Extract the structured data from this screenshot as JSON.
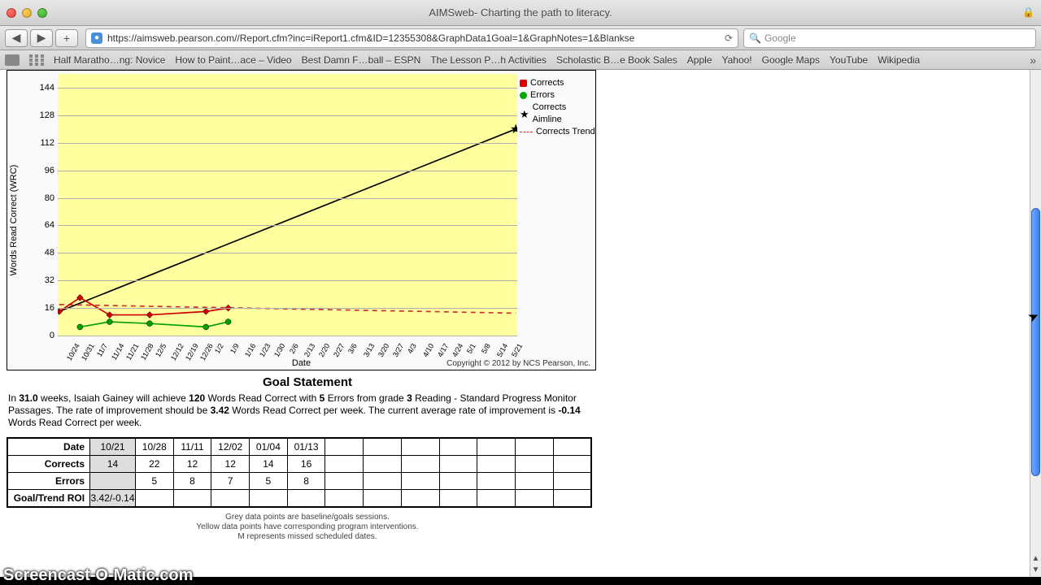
{
  "window": {
    "title": "AIMSweb- Charting the path to literacy."
  },
  "toolbar": {
    "back": "◀",
    "forward": "▶",
    "add": "+",
    "url": "https://aimsweb.pearson.com//Report.cfm?inc=iReport1.cfm&ID=12355308&GraphData1Goal=1&GraphNotes=1&Blankse",
    "reload": "⟳",
    "search_placeholder": "Google",
    "search_icon": "🔍"
  },
  "bookmarks": [
    "Half Maratho…ng: Novice",
    "How to Paint…ace – Video",
    "Best Damn F…ball – ESPN",
    "The Lesson P…h Activities",
    "Scholastic B…e Book Sales",
    "Apple",
    "Yahoo!",
    "Google Maps",
    "YouTube",
    "Wikipedia"
  ],
  "chart_data": {
    "type": "line",
    "xlabel": "Date",
    "ylabel": "Words Read Correct (WRC)",
    "y_ticks": [
      0,
      16,
      32,
      48,
      64,
      80,
      96,
      112,
      128,
      144
    ],
    "ylim": [
      0,
      152
    ],
    "x_categories": [
      "10/24",
      "10/31",
      "11/7",
      "11/14",
      "11/21",
      "11/28",
      "12/5",
      "12/12",
      "12/19",
      "12/26",
      "1/2",
      "1/9",
      "1/16",
      "1/23",
      "1/30",
      "2/6",
      "2/13",
      "2/20",
      "2/27",
      "3/6",
      "3/13",
      "3/20",
      "3/27",
      "4/3",
      "4/10",
      "4/17",
      "4/24",
      "5/1",
      "5/8",
      "5/14",
      "5/21"
    ],
    "series": [
      {
        "name": "Corrects",
        "color": "#d00000",
        "marker": "diamond",
        "points": [
          [
            -0.4,
            14
          ],
          [
            1,
            22
          ],
          [
            3,
            12
          ],
          [
            5.7,
            12
          ],
          [
            9.5,
            14
          ],
          [
            11,
            16
          ]
        ]
      },
      {
        "name": "Errors",
        "color": "#00a000",
        "marker": "circle",
        "points": [
          [
            1,
            5
          ],
          [
            3,
            8
          ],
          [
            5.7,
            7
          ],
          [
            9.5,
            5
          ],
          [
            11,
            8
          ]
        ]
      },
      {
        "name": "Corrects Aimline",
        "color": "#000000",
        "style": "solid",
        "endpoints": [
          [
            -0.4,
            14
          ],
          [
            30.4,
            120
          ]
        ]
      },
      {
        "name": "Corrects Trend",
        "color": "#cc3333",
        "style": "dashed",
        "endpoints": [
          [
            -0.4,
            18
          ],
          [
            30.4,
            13
          ]
        ]
      }
    ],
    "aimline_end_marker": "star",
    "legend": [
      "Corrects",
      "Errors",
      "Corrects Aimline",
      "Corrects Trend"
    ],
    "copyright": "Copyright © 2012 by NCS Pearson, Inc."
  },
  "goal": {
    "title": "Goal Statement",
    "weeks": "31.0",
    "student": "Isaiah Gainey",
    "target_wrc": "120",
    "target_errors": "5",
    "grade": "3",
    "rate_should": "3.42",
    "rate_current": "-0.14",
    "pre1": "In ",
    "post1": " weeks, ",
    "post2": " will achieve ",
    "post3": " Words Read Correct with ",
    "post4": " Errors from grade ",
    "post5": " Reading - Standard Progress Monitor Passages.  The rate of improvement should be ",
    "post6": " Words Read Correct per week. The current average rate of improvement is ",
    "post7": " Words Read Correct per week."
  },
  "table": {
    "row_labels": [
      "Date",
      "Corrects",
      "Errors",
      "Goal/Trend ROI"
    ],
    "cols": [
      "10/21",
      "10/28",
      "11/11",
      "12/02",
      "01/04",
      "01/13"
    ],
    "corrects": [
      "14",
      "22",
      "12",
      "12",
      "14",
      "16"
    ],
    "errors": [
      "",
      "5",
      "8",
      "7",
      "5",
      "8"
    ],
    "roi": [
      "3.42/-0.14",
      "",
      "",
      "",
      "",
      ""
    ],
    "empty_cols": 7
  },
  "notes": {
    "l1": "Grey data points are baseline/goals sessions.",
    "l2": "Yellow data points have corresponding program interventions.",
    "l3": "M represents missed scheduled dates."
  },
  "watermark": "Screencast-O-Matic.com"
}
